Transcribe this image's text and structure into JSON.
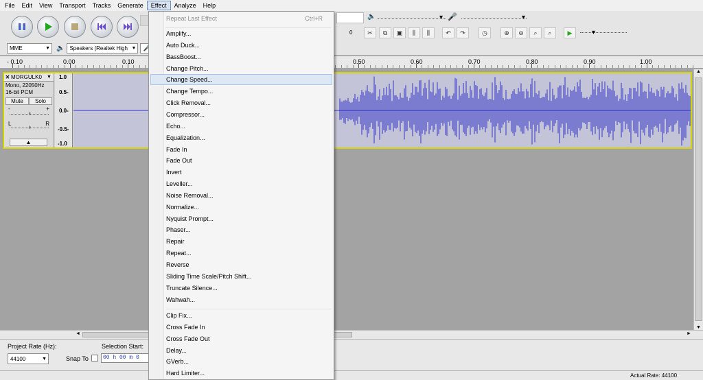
{
  "menubar": {
    "items": [
      "File",
      "Edit",
      "View",
      "Transport",
      "Tracks",
      "Generate",
      "Effect",
      "Analyze",
      "Help"
    ]
  },
  "devices": {
    "host": "MME",
    "output": "Speakers (Realtek High"
  },
  "ruler": {
    "labels": [
      "- 0.10",
      "0.00",
      "0.10",
      "0.50",
      "0.60",
      "0.70",
      "0.80",
      "0.90",
      "1.00"
    ]
  },
  "meter": {
    "zero_label": "0"
  },
  "track": {
    "name": "MORGULK0",
    "info_line1": "Mono, 22050Hz",
    "info_line2": "16-bit PCM",
    "mute_label": "Mute",
    "solo_label": "Solo",
    "gain_minus": "-",
    "gain_plus": "+",
    "pan_left": "L",
    "pan_right": "R",
    "scale": [
      "1.0",
      "0.5-",
      "0.0-",
      "-0.5-",
      "-1.0"
    ]
  },
  "bottom": {
    "project_rate_label": "Project Rate (Hz):",
    "project_rate_value": "44100",
    "snap_to_label": "Snap To",
    "selection_start_label": "Selection Start:",
    "selection_start_value": "00 h 00 m 0"
  },
  "status": {
    "actual_rate": "Actual Rate: 44100"
  },
  "effect_menu": {
    "repeat_last": "Repeat Last Effect",
    "repeat_last_shortcut": "Ctrl+R",
    "group1": [
      "Amplify...",
      "Auto Duck...",
      "BassBoost...",
      "Change Pitch...",
      "Change Speed...",
      "Change Tempo...",
      "Click Removal...",
      "Compressor...",
      "Echo...",
      "Equalization...",
      "Fade In",
      "Fade Out",
      "Invert",
      "Leveller...",
      "Noise Removal...",
      "Normalize...",
      "Nyquist Prompt...",
      "Phaser...",
      "Repair",
      "Repeat...",
      "Reverse",
      "Sliding Time Scale/Pitch Shift...",
      "Truncate Silence...",
      "Wahwah..."
    ],
    "group2": [
      "Clip Fix...",
      "Cross Fade In",
      "Cross Fade Out",
      "Delay...",
      "GVerb...",
      "Hard Limiter..."
    ],
    "hovered": "Change Speed..."
  },
  "colors": {
    "waveform": "#3232c8",
    "track_border": "#d4d400",
    "play_green": "#1fa81f",
    "transport_blue": "#4a63c9"
  }
}
